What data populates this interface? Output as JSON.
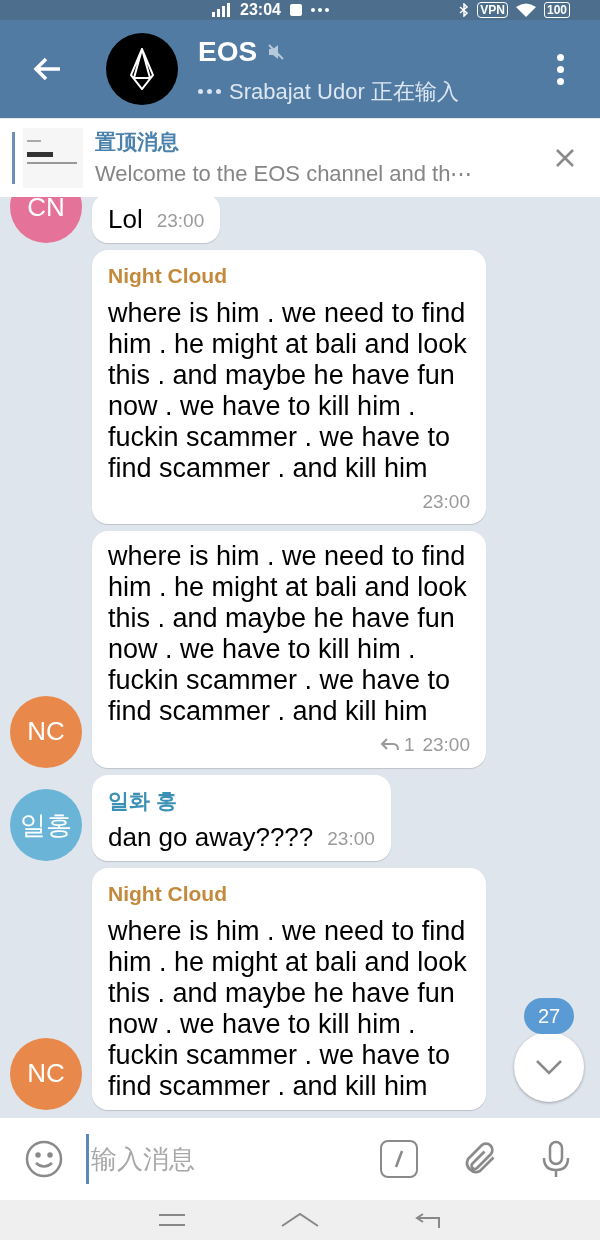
{
  "status_bar": {
    "time": "23:04",
    "vpn": "VPN",
    "battery": "100"
  },
  "header": {
    "title": "EOS",
    "muted": true,
    "typing": "Srabajat Udor 正在输入"
  },
  "pinned": {
    "label": "置顶消息",
    "text": "Welcome to the EOS channel and th⋯"
  },
  "messages": [
    {
      "text": "Lol",
      "time": "23:00",
      "avatar": {
        "initials": "CN",
        "color": "#e57399"
      }
    },
    {
      "sender": "Night Cloud",
      "color": "#c38a3d",
      "text": "where is him . we need to find him . he might at bali and look this . and maybe he have fun now . we have to kill him . fuckin scammer . we have to find scammer . and kill him",
      "time": "23:00"
    },
    {
      "text": "where is him . we need to find him . he might at bali and look this . and maybe he have fun now . we have to kill him . fuckin scammer . we have to find scammer . and kill him",
      "replies": "1",
      "time": "23:00",
      "avatar": {
        "initials": "NC",
        "color": "#e9884b"
      }
    },
    {
      "sender": "일화 홍",
      "color": "#3b90b3",
      "text": "dan go away????",
      "time": "23:00",
      "avatar": {
        "initials": "일홍",
        "color": "#6ab4d8"
      }
    },
    {
      "sender": "Night Cloud",
      "color": "#c38a3d",
      "text": "where is him . we need to find him . he might at bali and look this . and maybe he have fun now . we have to kill him . fuckin scammer . we have to find scammer . and kill him",
      "avatar": {
        "initials": "NC",
        "color": "#e9884b"
      }
    }
  ],
  "scroll_badge": "27",
  "composer": {
    "placeholder": "输入消息"
  }
}
